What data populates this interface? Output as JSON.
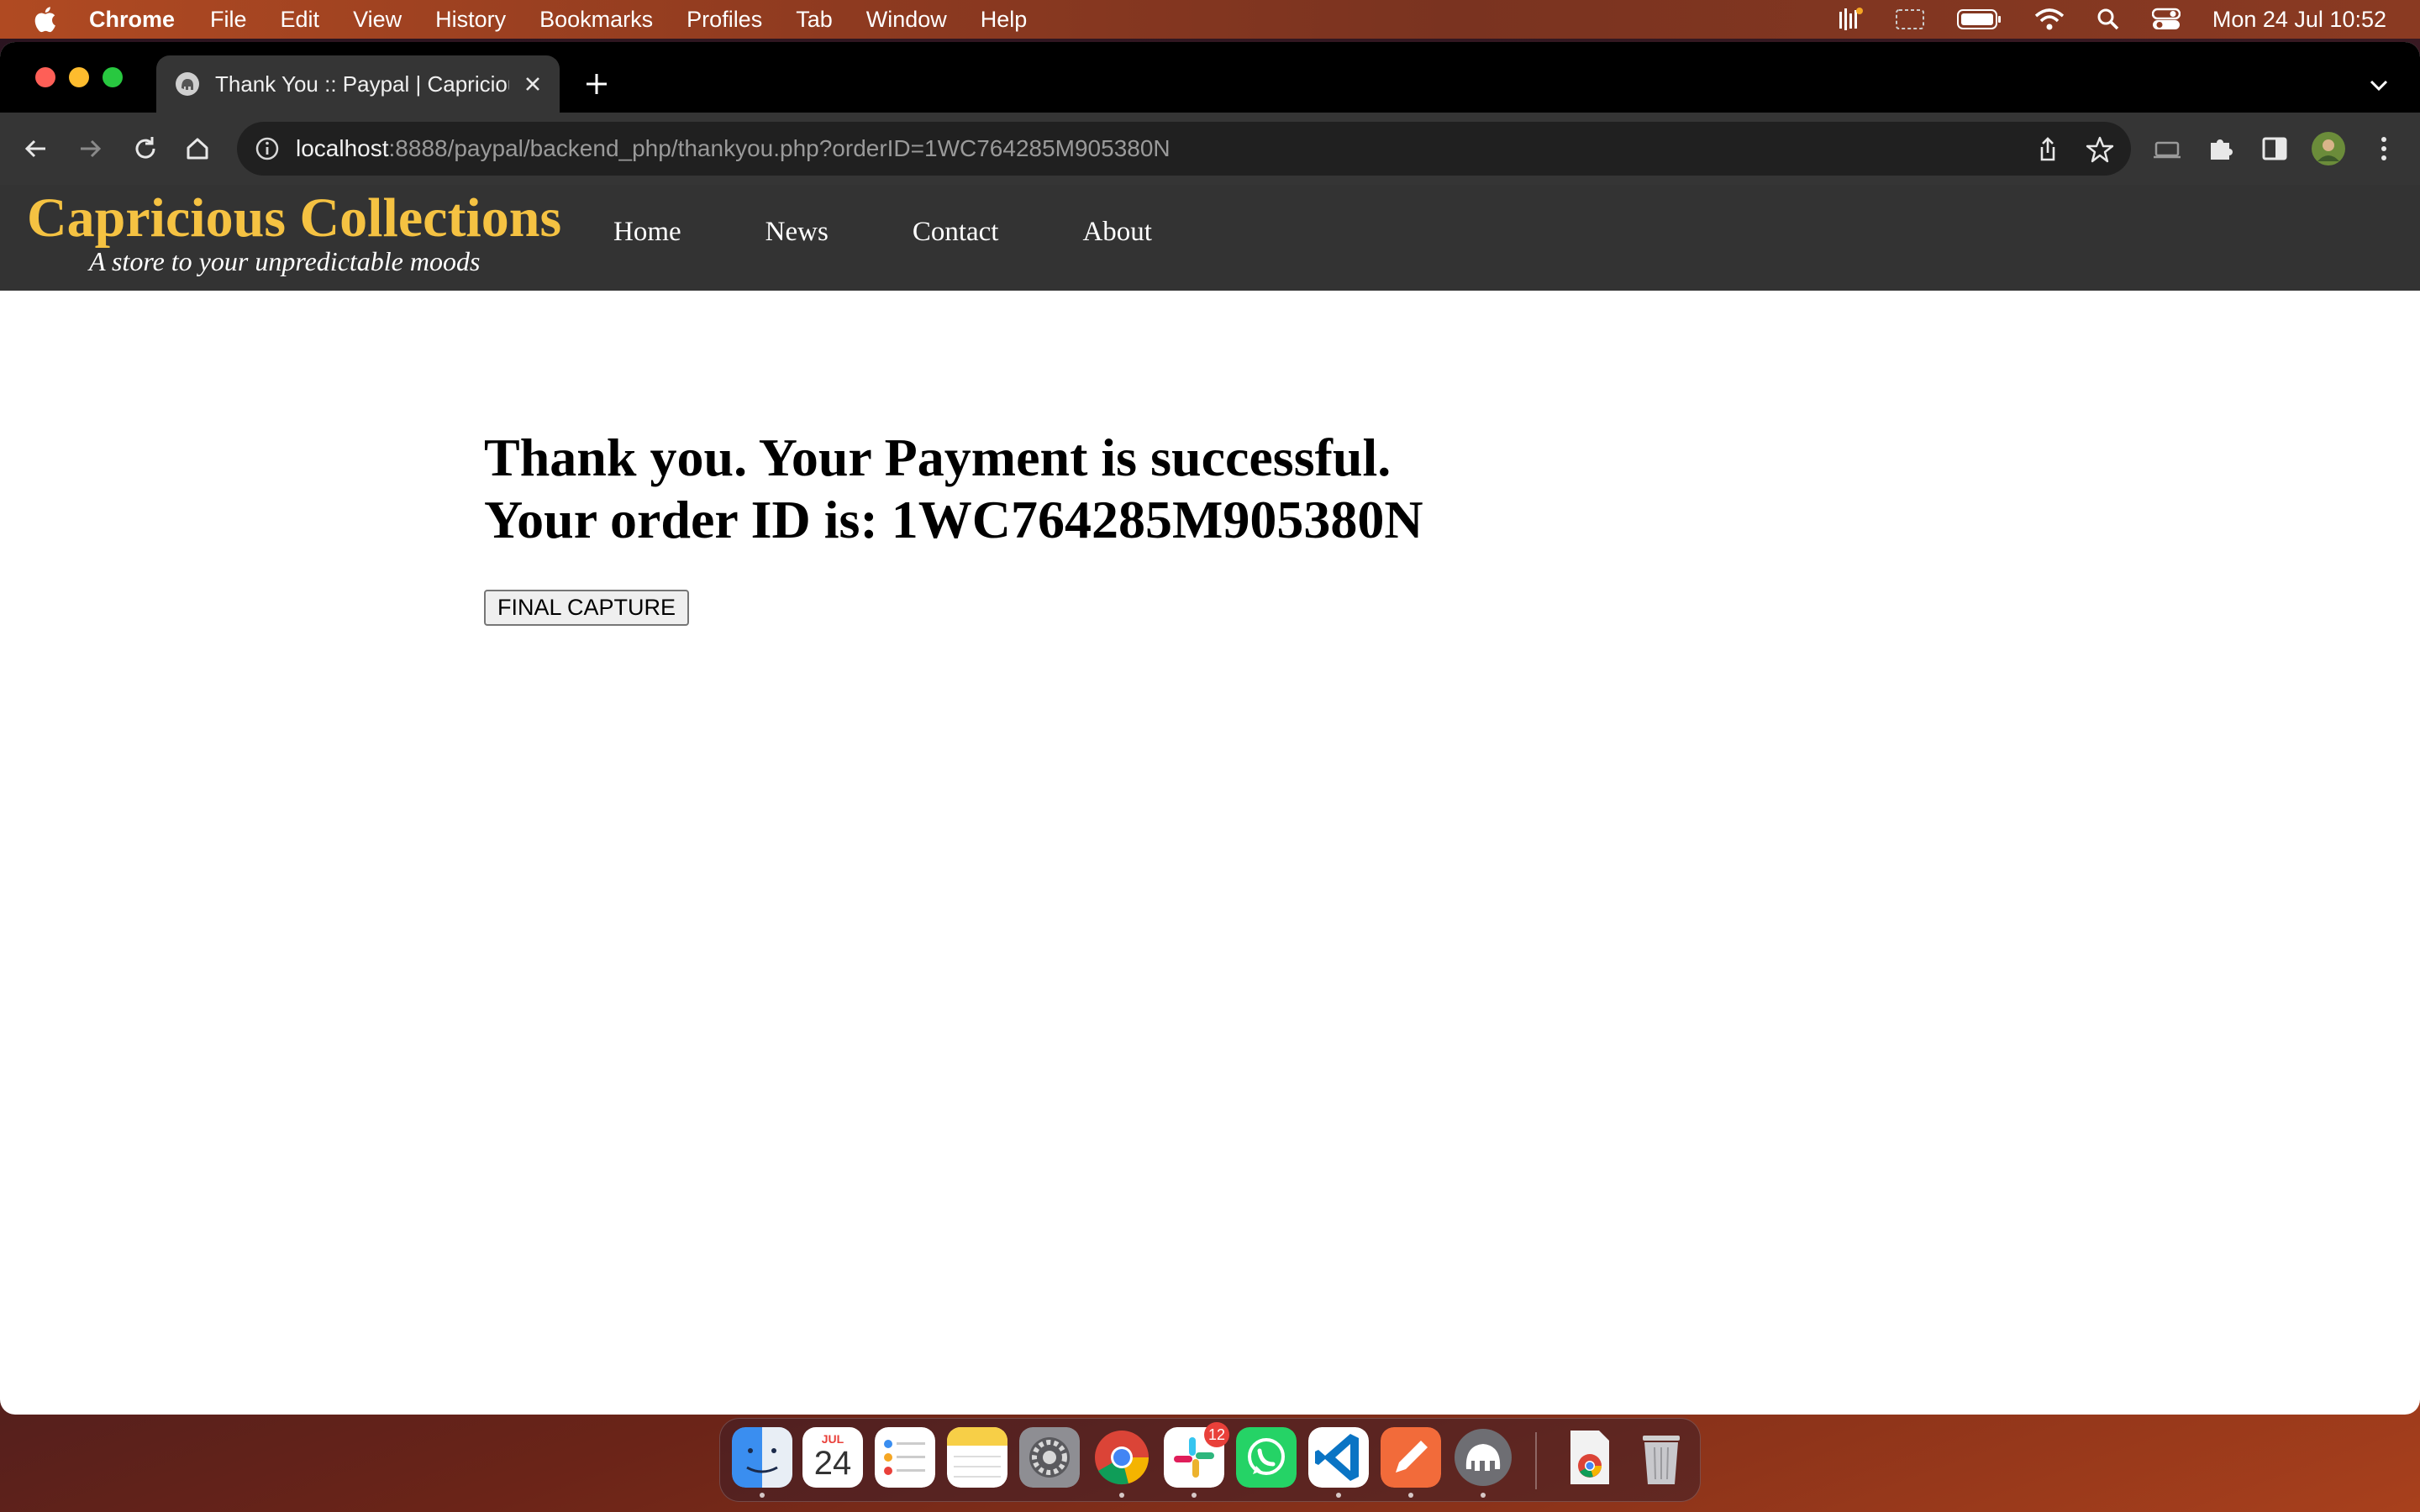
{
  "menubar": {
    "app_name": "Chrome",
    "items": [
      "File",
      "Edit",
      "View",
      "History",
      "Bookmarks",
      "Profiles",
      "Tab",
      "Window",
      "Help"
    ],
    "clock": "Mon 24 Jul  10:52"
  },
  "browser": {
    "tab_title": "Thank You :: Paypal | Capricious Collections",
    "url_host": "localhost",
    "url_rest": ":8888/paypal/backend_php/thankyou.php?orderID=1WC764285M905380N"
  },
  "site": {
    "brand_name": "Capricious Collections",
    "tagline": "A store to your unpredictable moods",
    "nav": [
      "Home",
      "News",
      "Contact",
      "About"
    ]
  },
  "main": {
    "line1": "Thank you. Your Payment is successful.",
    "line2": "Your order ID is: 1WC764285M905380N",
    "capture_button": "FINAL CAPTURE"
  },
  "dock": {
    "calendar_month": "JUL",
    "calendar_day": "24",
    "slack_badge": "12",
    "apps": [
      "finder-icon",
      "calendar-icon",
      "reminders-icon",
      "notes-icon",
      "system-settings-icon",
      "chrome-icon",
      "slack-icon",
      "whatsapp-icon",
      "vscode-icon",
      "pencil-app-icon",
      "mamp-icon",
      "chrome-document-icon",
      "trash-icon"
    ]
  },
  "colors": {
    "brand_gold": "#f5c242",
    "header_bg": "#333333",
    "toolbar_bg": "#353535"
  }
}
